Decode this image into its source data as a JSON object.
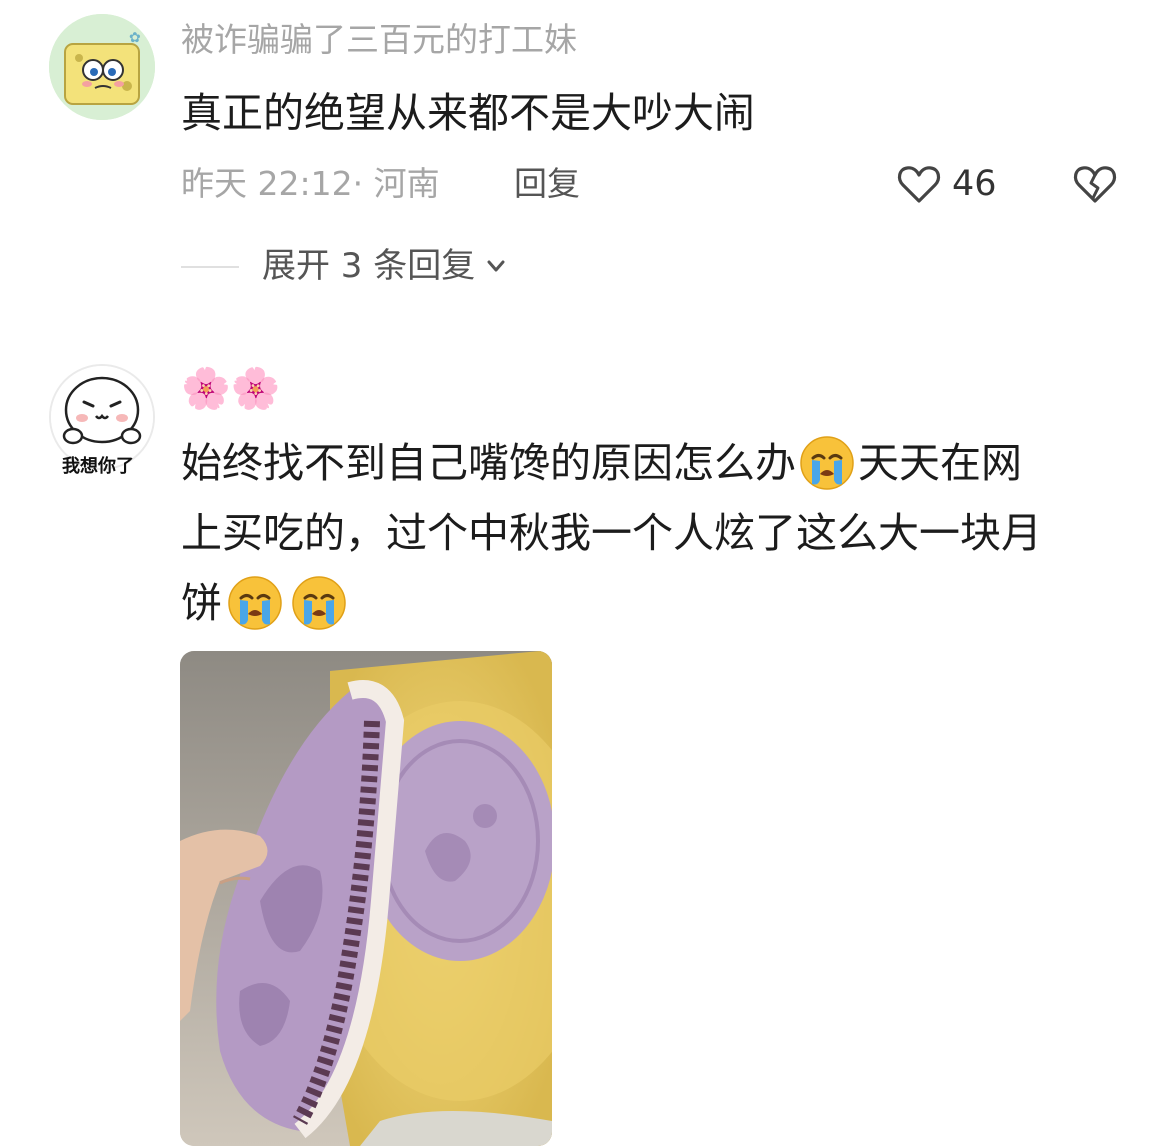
{
  "comment1": {
    "username": "被诈骗骗了三百元的打工妹",
    "text": "真正的绝望从来都不是大吵大闹",
    "time_location": "昨天 22:12· 河南",
    "reply_label": "回复",
    "likes": "46",
    "expand_label": "展开 3 条回复"
  },
  "comment2": {
    "username_emoji": "🌸🌸",
    "avatar_caption": "我想你了",
    "text_line1": "始终找不到自己嘴馋的原因怎么办",
    "text_line1_end": "天天在网",
    "text_line2": "上买吃的，过个中秋我一个人炫了这么大一块月",
    "text_line3": "饼"
  },
  "icons": {
    "like": "heart-outline-icon",
    "dislike": "broken-heart-icon",
    "expand": "chevron-down-icon",
    "emoji": "loudly-crying-face-emoji"
  },
  "colors": {
    "text_primary": "#1c1c1c",
    "text_secondary": "#a6a6a6",
    "mooncake": "#b89cc4",
    "tray": "#e8c966"
  }
}
